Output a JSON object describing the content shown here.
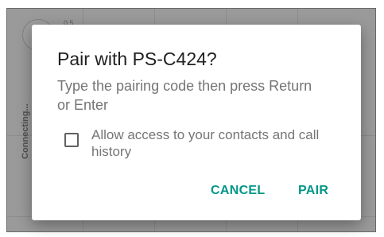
{
  "background": {
    "small_number": "0.5",
    "vertical_label": "Connecting..."
  },
  "dialog": {
    "title": "Pair with PS-C424?",
    "message": "Type the pairing code then press Return or Enter",
    "checkbox": {
      "label": "Allow access to your contacts and call history",
      "checked": false
    },
    "buttons": {
      "cancel": "CANCEL",
      "pair": "PAIR"
    }
  },
  "colors": {
    "accent": "#009688",
    "title_text": "#212121",
    "body_text": "#757575",
    "scrim": "rgba(0,0,0,0.32)"
  }
}
